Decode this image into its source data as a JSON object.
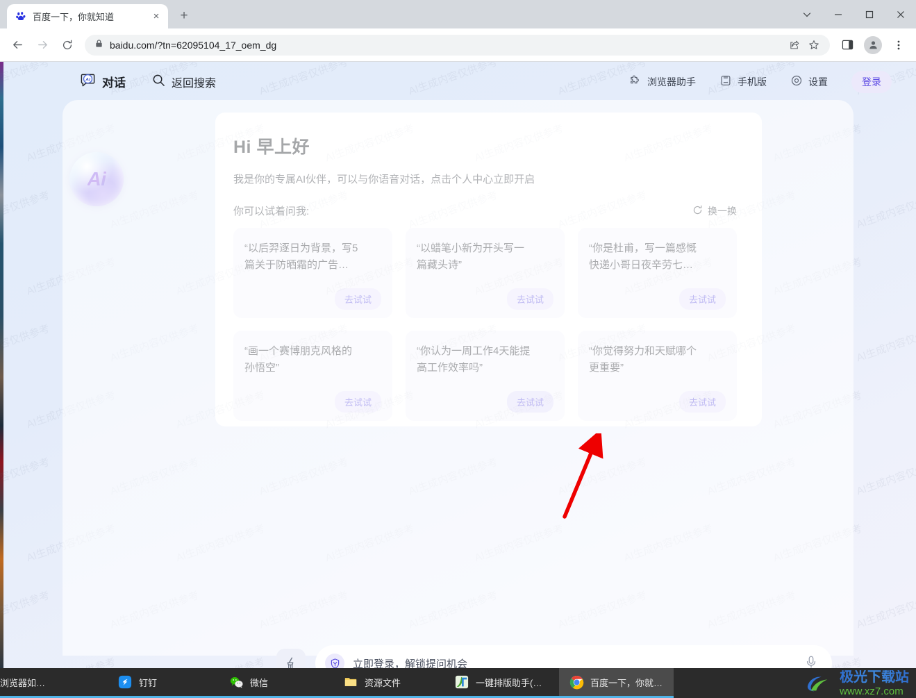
{
  "browser": {
    "tab": {
      "title": "百度一下，你就知道",
      "favicon": "baidu-paw-icon",
      "close": "×"
    },
    "new_tab_label": "+",
    "window_controls": [
      "tab-search",
      "minimize",
      "maximize",
      "close"
    ],
    "toolbar": {
      "back": "back-arrow-icon",
      "forward": "forward-arrow-icon",
      "reload": "reload-icon",
      "lock": "lock-icon",
      "url": "baidu.com/?tn=62095104_17_oem_dg",
      "share": "share-icon",
      "bookmark": "star-icon",
      "side_panel": "side-panel-icon",
      "profile": "profile-avatar-icon",
      "menu": "three-dot-menu-icon"
    }
  },
  "page": {
    "nav_left": [
      {
        "label": "对话",
        "icon": "ai-chat-icon"
      },
      {
        "label": "返回搜索",
        "icon": "search-icon"
      }
    ],
    "nav_right": [
      {
        "label": "浏览器助手",
        "icon": "puzzle-icon"
      },
      {
        "label": "手机版",
        "icon": "mobile-icon"
      },
      {
        "label": "设置",
        "icon": "gear-icon"
      }
    ],
    "login_label": "登录",
    "avatar_text": "Ai",
    "greeting": "Hi 早上好",
    "intro": "我是你的专属AI伙伴，可以与你语音对话，点击个人中心立即开启",
    "try_label": "你可以试着问我:",
    "refresh_label": "换一换",
    "refresh_icon": "refresh-circle-icon",
    "cards": [
      {
        "text": "“以后羿逐日为背景，写5\n 篇关于防晒霜的广告…",
        "button": "去试试",
        "highlighted": false
      },
      {
        "text": "“以蜡笔小新为开头写一\n 篇藏头诗”",
        "button": "去试试",
        "highlighted": false
      },
      {
        "text": "“你是杜甫，写一篇感慨\n 快递小哥日夜辛劳七…",
        "button": "去试试",
        "highlighted": false
      },
      {
        "text": "“画一个赛博朋克风格的\n 孙悟空”",
        "button": "去试试",
        "highlighted": false
      },
      {
        "text": "“你认为一周工作4天能提\n 高工作效率吗”",
        "button": "去试试",
        "highlighted": true
      },
      {
        "text": "“你觉得努力和天赋哪个\n 更重要”",
        "button": "去试试",
        "highlighted": false
      }
    ],
    "input": {
      "clear_icon": "broom-clear-icon",
      "badge_icon": "shield-badge-icon",
      "placeholder": "立即登录，解锁提问机会",
      "mic_icon": "microphone-icon"
    },
    "watermark_text": "AI生成内容仅供参考"
  },
  "taskbar": {
    "items": [
      {
        "label": "浏览器如…",
        "icon": "browser-icon",
        "active": false
      },
      {
        "label": "钉钉",
        "icon": "dingtalk-icon",
        "active": false
      },
      {
        "label": "微信",
        "icon": "wechat-icon",
        "active": false
      },
      {
        "label": "资源文件",
        "icon": "folder-icon",
        "active": false
      },
      {
        "label": "一键排版助手(MyE…",
        "icon": "typesetting-icon",
        "active": false
      },
      {
        "label": "百度一下，你就知…",
        "icon": "chrome-icon",
        "active": true
      }
    ],
    "brand_cn": "极光下载站",
    "brand_url": "www.xz7.com"
  },
  "colors": {
    "accent_purple": "#5b4ee0",
    "card_bg": "#f4f5fb",
    "button_bg": "#e6e3fb",
    "page_bg": "#e4ecfa"
  }
}
